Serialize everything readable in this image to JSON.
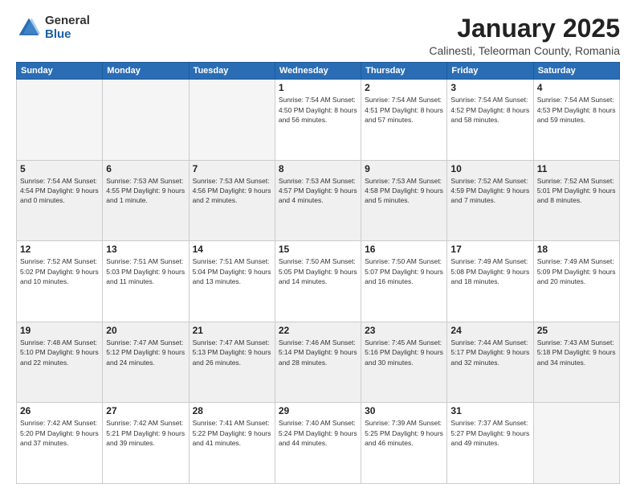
{
  "header": {
    "logo": {
      "general": "General",
      "blue": "Blue"
    },
    "title": "January 2025",
    "subtitle": "Calinesti, Teleorman County, Romania"
  },
  "days_of_week": [
    "Sunday",
    "Monday",
    "Tuesday",
    "Wednesday",
    "Thursday",
    "Friday",
    "Saturday"
  ],
  "weeks": [
    [
      {
        "day": "",
        "info": ""
      },
      {
        "day": "",
        "info": ""
      },
      {
        "day": "",
        "info": ""
      },
      {
        "day": "1",
        "info": "Sunrise: 7:54 AM\nSunset: 4:50 PM\nDaylight: 8 hours\nand 56 minutes."
      },
      {
        "day": "2",
        "info": "Sunrise: 7:54 AM\nSunset: 4:51 PM\nDaylight: 8 hours\nand 57 minutes."
      },
      {
        "day": "3",
        "info": "Sunrise: 7:54 AM\nSunset: 4:52 PM\nDaylight: 8 hours\nand 58 minutes."
      },
      {
        "day": "4",
        "info": "Sunrise: 7:54 AM\nSunset: 4:53 PM\nDaylight: 8 hours\nand 59 minutes."
      }
    ],
    [
      {
        "day": "5",
        "info": "Sunrise: 7:54 AM\nSunset: 4:54 PM\nDaylight: 9 hours\nand 0 minutes."
      },
      {
        "day": "6",
        "info": "Sunrise: 7:53 AM\nSunset: 4:55 PM\nDaylight: 9 hours\nand 1 minute."
      },
      {
        "day": "7",
        "info": "Sunrise: 7:53 AM\nSunset: 4:56 PM\nDaylight: 9 hours\nand 2 minutes."
      },
      {
        "day": "8",
        "info": "Sunrise: 7:53 AM\nSunset: 4:57 PM\nDaylight: 9 hours\nand 4 minutes."
      },
      {
        "day": "9",
        "info": "Sunrise: 7:53 AM\nSunset: 4:58 PM\nDaylight: 9 hours\nand 5 minutes."
      },
      {
        "day": "10",
        "info": "Sunrise: 7:52 AM\nSunset: 4:59 PM\nDaylight: 9 hours\nand 7 minutes."
      },
      {
        "day": "11",
        "info": "Sunrise: 7:52 AM\nSunset: 5:01 PM\nDaylight: 9 hours\nand 8 minutes."
      }
    ],
    [
      {
        "day": "12",
        "info": "Sunrise: 7:52 AM\nSunset: 5:02 PM\nDaylight: 9 hours\nand 10 minutes."
      },
      {
        "day": "13",
        "info": "Sunrise: 7:51 AM\nSunset: 5:03 PM\nDaylight: 9 hours\nand 11 minutes."
      },
      {
        "day": "14",
        "info": "Sunrise: 7:51 AM\nSunset: 5:04 PM\nDaylight: 9 hours\nand 13 minutes."
      },
      {
        "day": "15",
        "info": "Sunrise: 7:50 AM\nSunset: 5:05 PM\nDaylight: 9 hours\nand 14 minutes."
      },
      {
        "day": "16",
        "info": "Sunrise: 7:50 AM\nSunset: 5:07 PM\nDaylight: 9 hours\nand 16 minutes."
      },
      {
        "day": "17",
        "info": "Sunrise: 7:49 AM\nSunset: 5:08 PM\nDaylight: 9 hours\nand 18 minutes."
      },
      {
        "day": "18",
        "info": "Sunrise: 7:49 AM\nSunset: 5:09 PM\nDaylight: 9 hours\nand 20 minutes."
      }
    ],
    [
      {
        "day": "19",
        "info": "Sunrise: 7:48 AM\nSunset: 5:10 PM\nDaylight: 9 hours\nand 22 minutes."
      },
      {
        "day": "20",
        "info": "Sunrise: 7:47 AM\nSunset: 5:12 PM\nDaylight: 9 hours\nand 24 minutes."
      },
      {
        "day": "21",
        "info": "Sunrise: 7:47 AM\nSunset: 5:13 PM\nDaylight: 9 hours\nand 26 minutes."
      },
      {
        "day": "22",
        "info": "Sunrise: 7:46 AM\nSunset: 5:14 PM\nDaylight: 9 hours\nand 28 minutes."
      },
      {
        "day": "23",
        "info": "Sunrise: 7:45 AM\nSunset: 5:16 PM\nDaylight: 9 hours\nand 30 minutes."
      },
      {
        "day": "24",
        "info": "Sunrise: 7:44 AM\nSunset: 5:17 PM\nDaylight: 9 hours\nand 32 minutes."
      },
      {
        "day": "25",
        "info": "Sunrise: 7:43 AM\nSunset: 5:18 PM\nDaylight: 9 hours\nand 34 minutes."
      }
    ],
    [
      {
        "day": "26",
        "info": "Sunrise: 7:42 AM\nSunset: 5:20 PM\nDaylight: 9 hours\nand 37 minutes."
      },
      {
        "day": "27",
        "info": "Sunrise: 7:42 AM\nSunset: 5:21 PM\nDaylight: 9 hours\nand 39 minutes."
      },
      {
        "day": "28",
        "info": "Sunrise: 7:41 AM\nSunset: 5:22 PM\nDaylight: 9 hours\nand 41 minutes."
      },
      {
        "day": "29",
        "info": "Sunrise: 7:40 AM\nSunset: 5:24 PM\nDaylight: 9 hours\nand 44 minutes."
      },
      {
        "day": "30",
        "info": "Sunrise: 7:39 AM\nSunset: 5:25 PM\nDaylight: 9 hours\nand 46 minutes."
      },
      {
        "day": "31",
        "info": "Sunrise: 7:37 AM\nSunset: 5:27 PM\nDaylight: 9 hours\nand 49 minutes."
      },
      {
        "day": "",
        "info": ""
      }
    ]
  ]
}
